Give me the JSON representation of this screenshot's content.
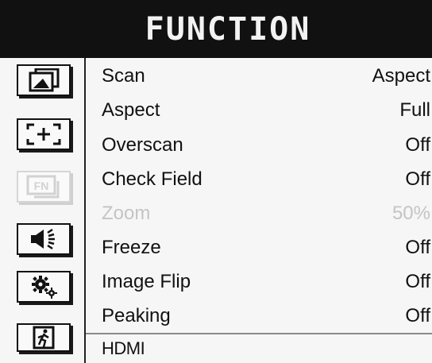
{
  "header": {
    "title": "FUNCTION"
  },
  "sidebar": {
    "items": [
      {
        "icon": "picture-icon",
        "selected": false
      },
      {
        "icon": "marker-icon",
        "selected": false
      },
      {
        "icon": "function-icon",
        "text": "FN",
        "selected": true
      },
      {
        "icon": "audio-icon",
        "selected": false
      },
      {
        "icon": "settings-icon",
        "selected": false
      },
      {
        "icon": "exit-icon",
        "selected": false
      }
    ]
  },
  "menu": {
    "items": [
      {
        "label": "Scan",
        "value": "Aspect",
        "enabled": true
      },
      {
        "label": "Aspect",
        "value": "Full",
        "enabled": true
      },
      {
        "label": "Overscan",
        "value": "Off",
        "enabled": true
      },
      {
        "label": "Check Field",
        "value": "Off",
        "enabled": true
      },
      {
        "label": "Zoom",
        "value": "50%",
        "enabled": false
      },
      {
        "label": "Freeze",
        "value": "Off",
        "enabled": true
      },
      {
        "label": "Image Flip",
        "value": "Off",
        "enabled": true
      },
      {
        "label": "Peaking",
        "value": "Off",
        "enabled": true
      }
    ]
  },
  "footer": {
    "input_source": "HDMI"
  },
  "colors": {
    "header_bg": "#111111",
    "header_text": "#f2f2f2",
    "disabled_text": "#c4c4c4",
    "selected_border": "#d6d6d6"
  }
}
